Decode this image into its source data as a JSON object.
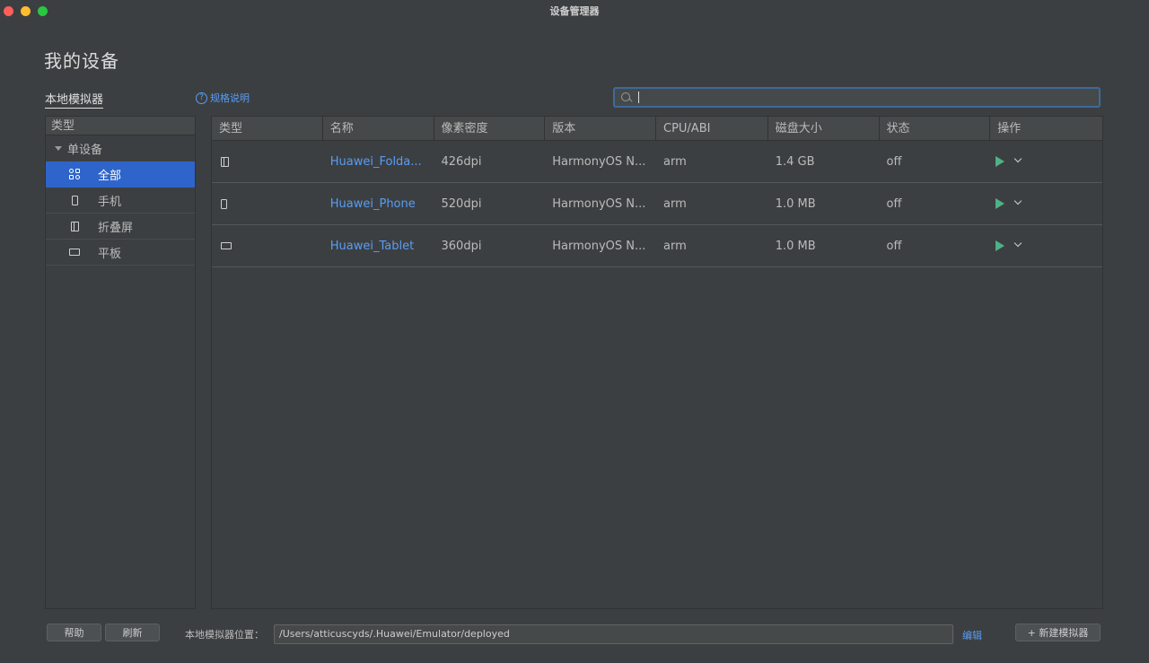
{
  "window": {
    "title": "设备管理器"
  },
  "page": {
    "title": "我的设备"
  },
  "tabs": {
    "local": "本地模拟器",
    "spec_link": "规格说明",
    "spec_icon": "?"
  },
  "search": {
    "value": "",
    "placeholder": ""
  },
  "sidebar": {
    "header": "类型",
    "group": "单设备",
    "items": [
      {
        "label": "全部",
        "icon": "grid-icon",
        "active": true
      },
      {
        "label": "手机",
        "icon": "phone-icon"
      },
      {
        "label": "折叠屏",
        "icon": "foldable-icon"
      },
      {
        "label": "平板",
        "icon": "tablet-icon"
      }
    ]
  },
  "table": {
    "columns": [
      "类型",
      "名称",
      "像素密度",
      "版本",
      "CPU/ABI",
      "磁盘大小",
      "状态",
      "操作"
    ],
    "rows": [
      {
        "type_icon": "foldable-icon",
        "name": "Huawei_Folda...",
        "density": "426dpi",
        "version": "HarmonyOS N...",
        "cpu": "arm",
        "disk": "1.4 GB",
        "status": "off"
      },
      {
        "type_icon": "phone-icon",
        "name": "Huawei_Phone",
        "density": "520dpi",
        "version": "HarmonyOS N...",
        "cpu": "arm",
        "disk": "1.0 MB",
        "status": "off"
      },
      {
        "type_icon": "tablet-icon",
        "name": "Huawei_Tablet",
        "density": "360dpi",
        "version": "HarmonyOS N...",
        "cpu": "arm",
        "disk": "1.0 MB",
        "status": "off"
      }
    ]
  },
  "footer": {
    "help": "帮助",
    "refresh": "刷新",
    "location_label": "本地模拟器位置：",
    "location_value": "/Users/atticuscyds/.Huawei/Emulator/deployed",
    "edit": "编辑",
    "new_emulator": "+ 新建模拟器"
  },
  "colors": {
    "accent": "#2f65ca",
    "link": "#589df6",
    "play": "#4fb286",
    "background": "#3c3f41"
  }
}
